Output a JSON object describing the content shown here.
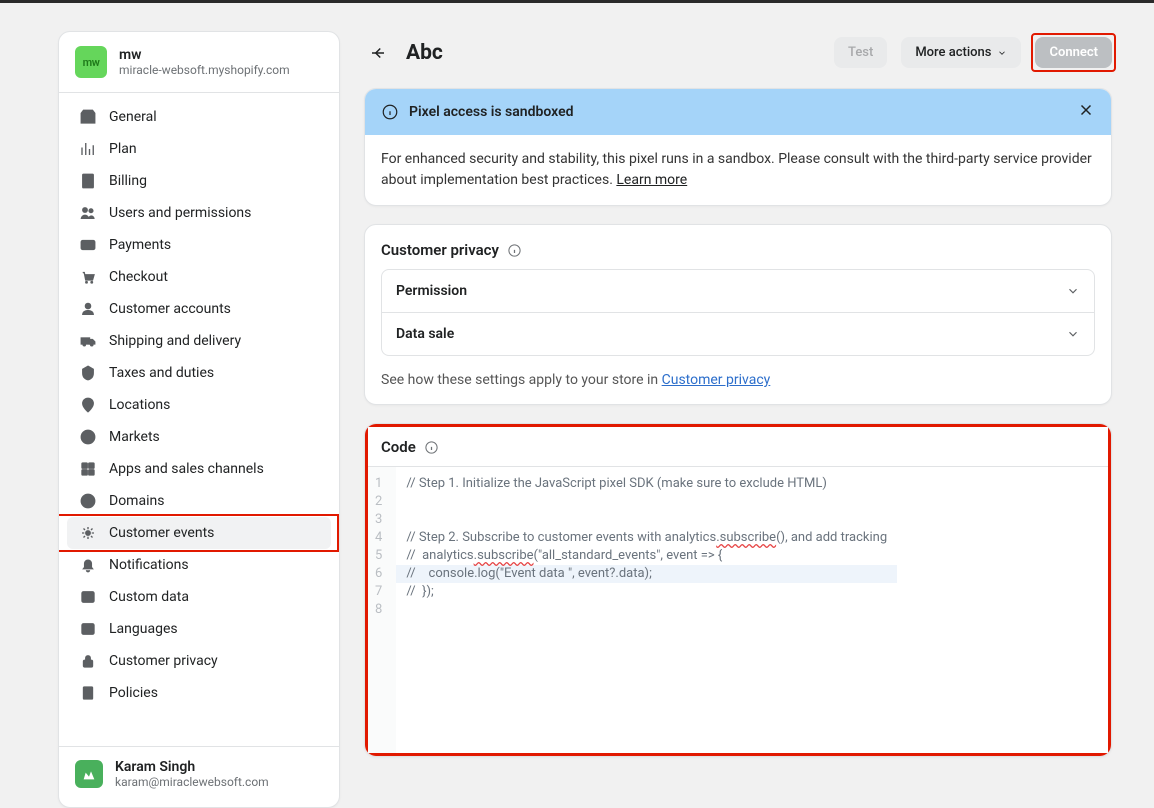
{
  "store": {
    "badge": "mw",
    "name": "mw",
    "domain": "miracle-websoft.myshopify.com"
  },
  "nav": [
    {
      "icon": "general",
      "label": "General"
    },
    {
      "icon": "plan",
      "label": "Plan"
    },
    {
      "icon": "billing",
      "label": "Billing"
    },
    {
      "icon": "users",
      "label": "Users and permissions"
    },
    {
      "icon": "payments",
      "label": "Payments"
    },
    {
      "icon": "checkout",
      "label": "Checkout"
    },
    {
      "icon": "accounts",
      "label": "Customer accounts"
    },
    {
      "icon": "shipping",
      "label": "Shipping and delivery"
    },
    {
      "icon": "taxes",
      "label": "Taxes and duties"
    },
    {
      "icon": "locations",
      "label": "Locations"
    },
    {
      "icon": "markets",
      "label": "Markets"
    },
    {
      "icon": "apps",
      "label": "Apps and sales channels"
    },
    {
      "icon": "domains",
      "label": "Domains"
    },
    {
      "icon": "events",
      "label": "Customer events",
      "active": true,
      "ring": true
    },
    {
      "icon": "notifications",
      "label": "Notifications"
    },
    {
      "icon": "customdata",
      "label": "Custom data"
    },
    {
      "icon": "languages",
      "label": "Languages"
    },
    {
      "icon": "privacy",
      "label": "Customer privacy"
    },
    {
      "icon": "policies",
      "label": "Policies"
    }
  ],
  "user": {
    "name": "Karam Singh",
    "email": "karam@miraclewebsoft.com"
  },
  "header": {
    "title": "Abc",
    "test_label": "Test",
    "more_label": "More actions",
    "connect_label": "Connect"
  },
  "banner": {
    "title": "Pixel access is sandboxed",
    "body": "For enhanced security and stability, this pixel runs in a sandbox. Please consult with the third-party service provider about implementation best practices. ",
    "learn_more": "Learn more"
  },
  "privacy": {
    "title": "Customer privacy",
    "rows": [
      "Permission",
      "Data sale"
    ],
    "note_prefix": "See how these settings apply to your store in ",
    "note_link": "Customer privacy"
  },
  "code": {
    "title": "Code",
    "lines": [
      "// Step 1. Initialize the JavaScript pixel SDK (make sure to exclude HTML)",
      "",
      "",
      "// Step 2. Subscribe to customer events with analytics.subscribe(), and add tracking",
      "//  analytics.subscribe(\"all_standard_events\", event => {",
      "//    console.log(\"Event data \", event?.data);",
      "//  });",
      ""
    ],
    "wavy_segment": ".subscribe",
    "highlight_line_index": 5
  }
}
